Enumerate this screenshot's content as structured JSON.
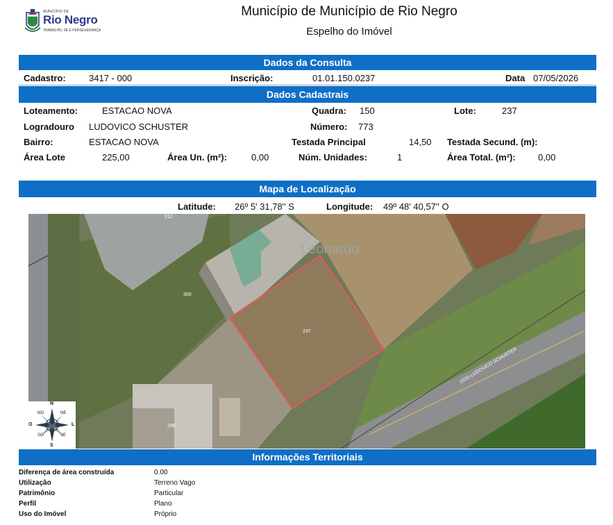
{
  "header": {
    "logo_small": "MUNICÍPIO DE",
    "logo_name": "Rio Negro",
    "logo_tagline": "TRABALHO, FÉ E PERSEVERANÇA",
    "title": "Município de Município de Rio Negro",
    "subtitle": "Espelho do Imóvel"
  },
  "colors": {
    "section_bar": "#0f6fc6",
    "lot_outline": "#e8585c"
  },
  "consulta": {
    "section_title": "Dados da Consulta",
    "cadastro_label": "Cadastro:",
    "cadastro_value": "3417 - 000",
    "inscricao_label": "Inscrição:",
    "inscricao_value": "01.01.150.0237",
    "data_label": "Data",
    "data_value": "07/05/2026"
  },
  "cadastrais": {
    "section_title": "Dados Cadastrais",
    "loteamento_label": "Loteamento:",
    "loteamento_value": "ESTACAO NOVA",
    "quadra_label": "Quadra:",
    "quadra_value": "150",
    "lote_label": "Lote:",
    "lote_value": "237",
    "logradouro_label": "Logradouro",
    "logradouro_value": "LUDOVICO SCHUSTER",
    "numero_label": "Número:",
    "numero_value": "773",
    "bairro_label": "Bairro:",
    "bairro_value": "ESTACAO NOVA",
    "testada_principal_label": "Testada Principal",
    "testada_principal_value": "14,50",
    "testada_secund_label": "Testada Secund. (m):",
    "area_lote_label": "Área Lote",
    "area_lote_value": "225,00",
    "area_un_label": "Área Un. (m²):",
    "area_un_value": "0,00",
    "num_unidades_label": "Núm. Unidades:",
    "num_unidades_value": "1",
    "area_total_label": "Área Total. (m²):",
    "area_total_value": "0,00"
  },
  "mapa": {
    "section_title": "Mapa de Localização",
    "latitude_label": "Latitude:",
    "latitude_value": "26º 5' 31,78'' S",
    "longitude_label": "Longitude:",
    "longitude_value": "49º 48' 40,57'' O",
    "watermark": "Leonardo",
    "lot_labels": {
      "lot_312": "312",
      "lot_300": "300",
      "lot_237": "237",
      "lot_288": "288"
    },
    "street_label": "1032-LUDOVICO SCHUSTER",
    "compass": {
      "n": "N",
      "s": "S",
      "o": "O",
      "l": "L",
      "no": "NO",
      "ne": "NE",
      "so": "SO",
      "se": "SE"
    }
  },
  "territoriais": {
    "section_title": "Informações Territoriais",
    "rows": [
      {
        "label": "Diferença de área construída",
        "value": "0.00"
      },
      {
        "label": "Utilização",
        "value": "Terreno Vago"
      },
      {
        "label": "Patrimônio",
        "value": "Particular"
      },
      {
        "label": "Perfil",
        "value": "Plano"
      },
      {
        "label": "Uso do Imóvel",
        "value": "Próprio"
      }
    ]
  }
}
